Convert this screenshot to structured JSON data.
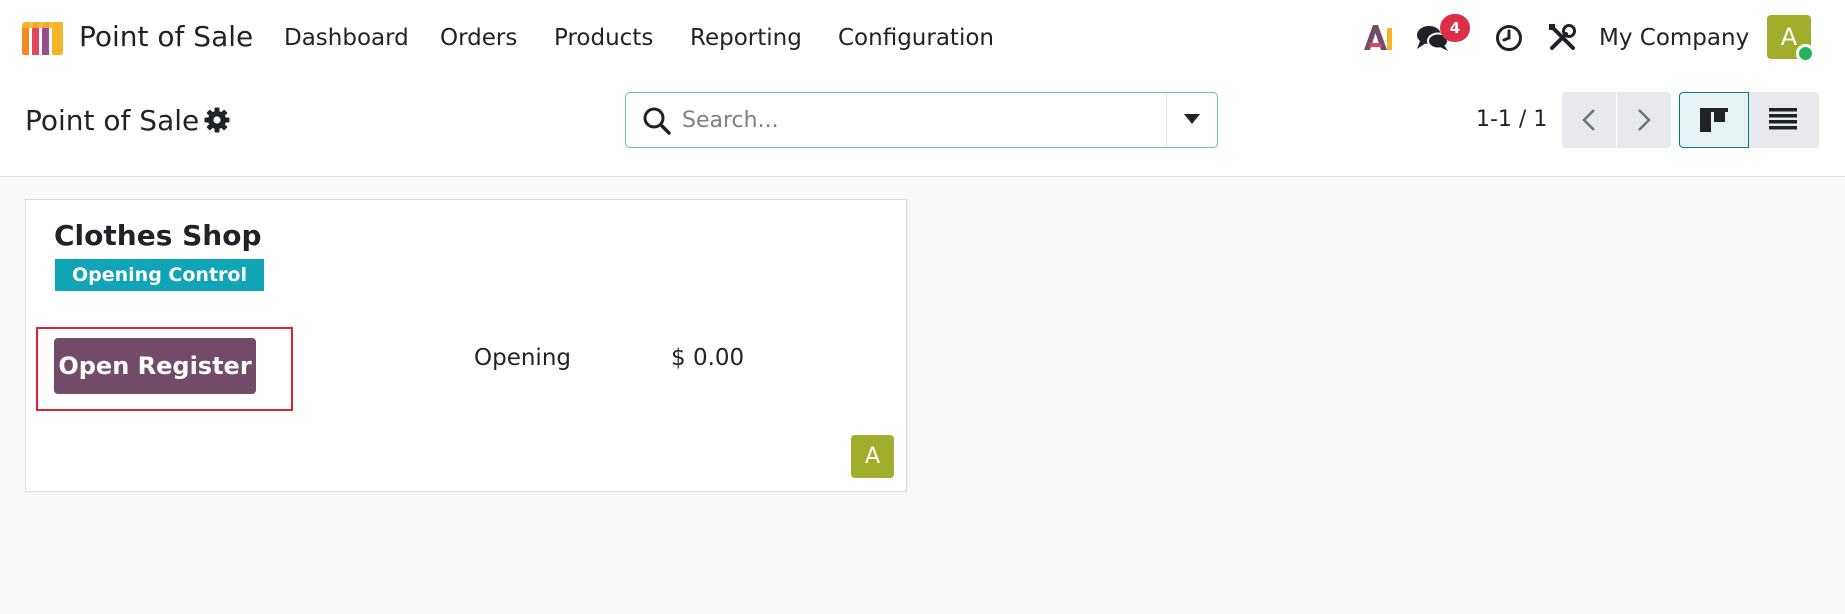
{
  "navbar": {
    "app_name": "Point of Sale",
    "menu": [
      "Dashboard",
      "Orders",
      "Products",
      "Reporting",
      "Configuration"
    ],
    "ai_icon": "ai-icon",
    "messages_icon": "chat-bubbles-icon",
    "messages_count": "4",
    "activity_icon": "clock-icon",
    "debug_icon": "tools-icon",
    "company": "My Company",
    "user_initial": "A"
  },
  "control": {
    "breadcrumb": "Point of Sale",
    "settings_icon": "gear-icon",
    "search_placeholder": "Search...",
    "pager": "1-1 / 1",
    "views": [
      "kanban-view-icon",
      "list-view-icon"
    ]
  },
  "card": {
    "title": "Clothes Shop",
    "tag": "Opening Control",
    "button_label": "Open Register",
    "stat_label": "Opening",
    "stat_value": "$ 0.00",
    "user_initial": "A"
  },
  "colors": {
    "primary": "#714b67",
    "tag": "#0fa5b7",
    "avatar": "#a1ae2c",
    "badge": "#dc2f45",
    "highlight": "#e0222c"
  }
}
